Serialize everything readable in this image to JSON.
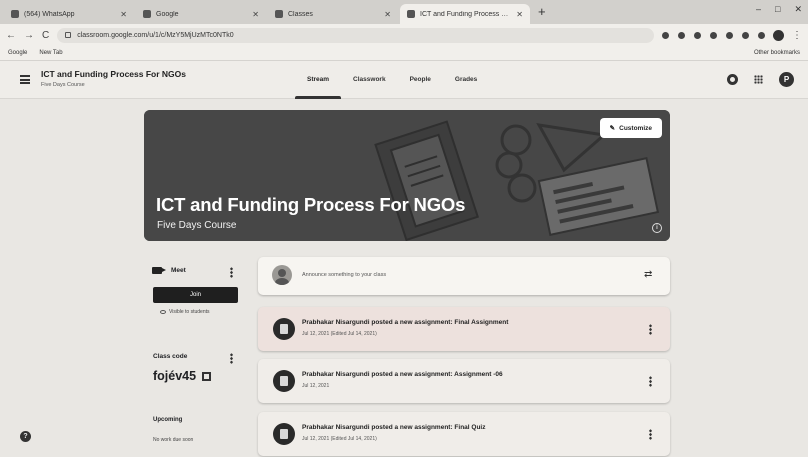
{
  "browser": {
    "tabs": [
      {
        "title": "(564) WhatsApp",
        "active": false
      },
      {
        "title": "Google",
        "active": false
      },
      {
        "title": "Classes",
        "active": false
      },
      {
        "title": "ICT and Funding Process For NGOs",
        "active": true
      }
    ],
    "url": "classroom.google.com/u/1/c/MzY5MjUzMTc0NTk0",
    "bookmarks": [
      "Google",
      "New Tab"
    ],
    "other_bookmarks": "Other bookmarks"
  },
  "header": {
    "course_title": "ICT and Funding Process For NGOs",
    "course_subtitle": "Five Days Course",
    "tabs": [
      "Stream",
      "Classwork",
      "People",
      "Grades"
    ],
    "active_tab": "Stream",
    "avatar_letter": "P"
  },
  "banner": {
    "title": "ICT and Funding Process For NGOs",
    "subtitle": "Five Days Course",
    "customize_label": "Customize"
  },
  "sidebar": {
    "meet_label": "Meet",
    "join_label": "Join",
    "visible_label": "Visible to students",
    "class_code_label": "Class code",
    "class_code": "fojév45",
    "upcoming_label": "Upcoming",
    "upcoming_text": "No work due soon"
  },
  "stream": {
    "announce_placeholder": "Announce something to your class",
    "posts": [
      {
        "title": "Prabhakar Nisargundi posted a new assignment: Final Assignment",
        "date": "Jul 12, 2021 (Edited Jul 14, 2021)"
      },
      {
        "title": "Prabhakar Nisargundi posted a new assignment: Assignment -06",
        "date": "Jul 12, 2021"
      },
      {
        "title": "Prabhakar Nisargundi posted a new assignment: Final Quiz",
        "date": "Jul 12, 2021 (Edited Jul 14, 2021)"
      }
    ]
  }
}
